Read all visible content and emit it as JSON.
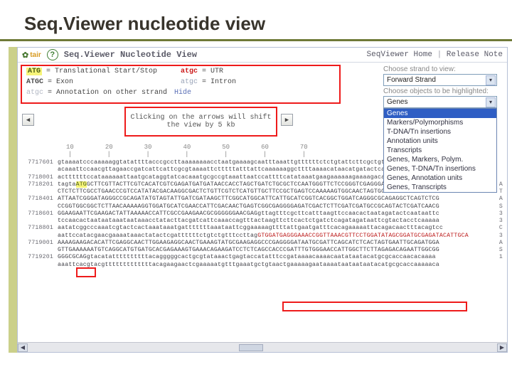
{
  "slide": {
    "title": "Seq.Viewer nucleotide view"
  },
  "header": {
    "brand": "tair",
    "help_glyph": "?",
    "app_title": "Seq.Viewer Nucleotide View",
    "links": {
      "home": "SeqViewer Home",
      "release": "Release Note"
    }
  },
  "legend": {
    "start_stop_key": "ATG",
    "start_stop_label": "= Translational Start/Stop",
    "utr_key": "atgc",
    "utr_label": "= UTR",
    "exon_key": "ATGC",
    "exon_label": "= Exon",
    "intron_key": "atgc",
    "intron_label": "= Intron",
    "other_key": "atgc",
    "other_label": "= Annotation on other strand",
    "hide": "Hide",
    "arrow_help": "Clicking on the arrows will shift the view by 5 kb"
  },
  "controls": {
    "strand_label": "Choose strand to view:",
    "strand_value": "Forward Strand",
    "objects_label": "Choose objects to be highlighted:",
    "objects_value": "Genes",
    "objects_options": [
      "Genes",
      "Markers/Polymorphisms",
      "T-DNA/Tn insertions",
      "Annotation units",
      "Transcripts",
      "Genes, Markers, Polym.",
      "Genes, T-DNA/Tn insertions",
      "Genes, Annotation units",
      "Genes, Transcripts"
    ]
  },
  "arrows": {
    "left": "◀",
    "right": "▶"
  },
  "ruler": [
    "10",
    "20",
    "30",
    "40",
    "50",
    "60",
    "70"
  ],
  "seq": {
    "rows": [
      {
        "pos": "7717601",
        "a": "gtaaaatcccaaaaaggtatattttacccgccttaaaaaaaacctaatgaaaagcaatttaaattgttttttctctgtattcttcgctgtacttt",
        "b": "",
        "tail": ""
      },
      {
        "pos": "",
        "a": "acaaattccaacgttagaaccgatcattcattcgcgtaaaattctttttatttattcaaaaaaggcttttaaaacataacatgatactcataag",
        "b": "",
        "tail": ""
      },
      {
        "pos": "7718001",
        "a": "acttttttccataaaaaattaatgcataggtatcacaaatgcgccgtaaattaatccattttcatataaatgaagaaaaaagaaaagacataaa",
        "b": "",
        "tail": ""
      },
      {
        "pos": "7718201",
        "a": "tagta",
        "b": "",
        "start": "ATG",
        "c": "GCTTCGTTACTTCGTCACATCGTCGAGATGATGATAACCACCTAGCTGATCTGCGCTCCAATGGGTTCTCCGGGTCGAGGGATTACCCATCGGGATCTTCTTTCC",
        "tail": "A"
      },
      {
        "pos": "",
        "a": "CTCTCTTCGCCTGAACCCGTCCATATACGACAAGGCGACTCTGTTCGTCTCATGTTGCTTCCGCTGAGTCCAAAAAGTGGCAACTAGTGCTACTGATCTCAA",
        "b": "",
        "tail": "T"
      },
      {
        "pos": "7718401",
        "a": "ATTAATCGGGATAGGGCCGCAGATATGTAGTATTGATCGATAAGCTTCGGCATGGCATTCATTGCATCGGTCACGGCTGGATCAGGGCGCAGAGGCTCAGTCTCG",
        "b": "",
        "tail": "A"
      },
      {
        "pos": "",
        "a": "CCGGTGGCGGCTCTTAACAAAAAGGTGGATGCATCGAACCATTCGACAACTGAGTCGGCGAGGGGAGATCGACTCTTCGATCGATGCCGCAGTACTCGATCAACG",
        "b": "",
        "tail": "S"
      },
      {
        "pos": "7718601",
        "a": "GGAAGAATTCGAAGACTATTAAAAACCATTCGCCGAAGAACGCGGGGGGAACGAGgttagtttcgcttcatttaagttccaacactaatagatactcaataattc",
        "b": "",
        "tail": "3"
      },
      {
        "pos": "",
        "a": "tccaacactaataataaataataaacctatacttacgatcattcaaaccagtttactaagttcttcactctgatctcagatagataattcgtactacctcaaaaa",
        "b": "",
        "tail": "3"
      },
      {
        "pos": "7718801",
        "a": "aatatcggcccaaatcgtactcactaaataaatgatttttttaaataattcggaaaaagttttattgaatgatttcacagaaaaattacagacaactttacagtcc",
        "b": "",
        "tail": "C"
      },
      {
        "pos": "",
        "a": "aattccatacgaacgaaaataaactatactcgattttttctgtctgtttccttag",
        "b": "GTGGATGAGGGAAACCGGTTAAACGTTCCTGGATATAGCGGATGCGAGATACATTGCA",
        "tail": "3"
      },
      {
        "pos": "7719001",
        "a": "AAAAGAAGACACATTCGAGGCAACTTGGAAGAGGCAACTGAAAGTATGCGAAGAGGCCCGAGGGGATAATGCGATTCAGCATCTCACTAGTGAATTGCAGATGGA",
        "b": "",
        "tail": "A"
      },
      {
        "pos": "",
        "a": "GTTGAAAAAATGTCAGGCATGTGATGCACGAGAAAGTGAAACAGAAGATCCTCTCAGCCACCCGATTTGTGGGAACCATTGGCTTCTTAGAGACAGAATTGGCGG",
        "b": "",
        "tail": "S"
      },
      {
        "pos": "7719201",
        "a": "GGGCGCAGgtacatattttttttttacagggggcactgcgtataaactgagtaccatatttccgataaaacaaaacaatataatacatgcgcaccaacacaaaa",
        "b": "",
        "tail": "1"
      },
      {
        "pos": "",
        "a": "aaattcacgtacgtttttttttttttacagaagaactcgaaaaatgtttgaaatgctgtaactgaaaaagaataaaataataataatacatgcgcaccaaaaaca",
        "b": "",
        "tail": ""
      }
    ]
  }
}
